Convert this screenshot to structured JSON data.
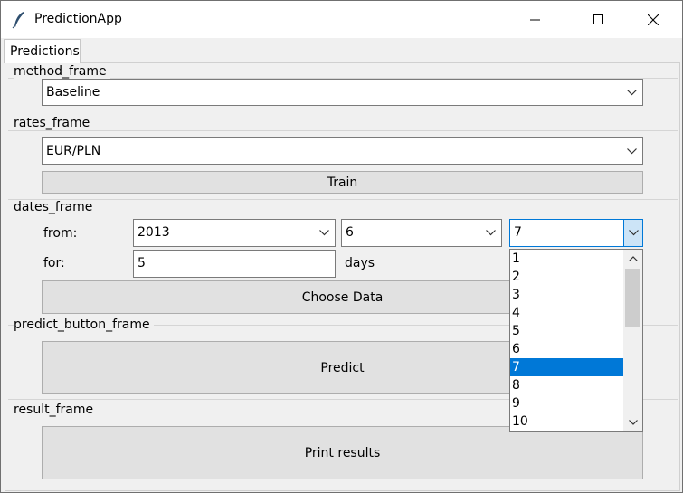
{
  "window": {
    "title": "PredictionApp"
  },
  "tabs": [
    {
      "label": "Predictions"
    }
  ],
  "method_frame": {
    "label": "method_frame",
    "method_value": "Baseline"
  },
  "rates_frame": {
    "label": "rates_frame",
    "rate_value": "EUR/PLN",
    "train_label": "Train"
  },
  "dates_frame": {
    "label": "dates_frame",
    "from_label": "from:",
    "year_value": "2013",
    "month_value": "6",
    "day_value": "7",
    "for_label": "for:",
    "days_value": "5",
    "days_label": "days",
    "choose_data_label": "Choose Data"
  },
  "day_dropdown": {
    "options": [
      "1",
      "2",
      "3",
      "4",
      "5",
      "6",
      "7",
      "8",
      "9",
      "10"
    ],
    "selected": "7"
  },
  "predict_button_frame": {
    "label": "predict_button_frame",
    "predict_label": "Predict"
  },
  "result_frame": {
    "label": "result_frame",
    "print_label": "Print results"
  },
  "colors": {
    "selection": "#0078d7",
    "button_bg": "#e1e1e1",
    "window_bg": "#f0f0f0"
  },
  "icons": {
    "app": "feather-icon",
    "minimize": "minimize-icon",
    "maximize": "maximize-icon",
    "close": "close-icon",
    "dropdown": "chevron-down-icon",
    "scroll_up": "chevron-up-icon",
    "scroll_down": "chevron-down-icon"
  }
}
